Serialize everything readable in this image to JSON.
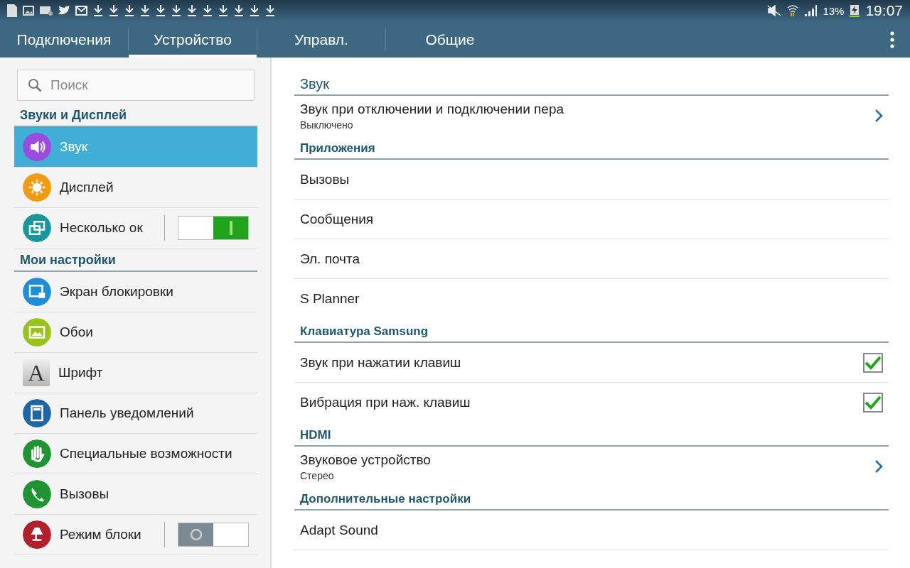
{
  "status_bar": {
    "battery": "13%",
    "time": "19:07"
  },
  "tabs": [
    {
      "label": "Подключения",
      "selected": false
    },
    {
      "label": "Устройство",
      "selected": true
    },
    {
      "label": "Управл.",
      "selected": false
    },
    {
      "label": "Общие",
      "selected": false
    }
  ],
  "sidebar": {
    "search": {
      "placeholder": "Поиск"
    },
    "groups": [
      {
        "title": "Звуки и Дисплей",
        "items": [
          {
            "label": "Звук",
            "color": "#9b4be0",
            "selected": true,
            "kind": "link"
          },
          {
            "label": "Дисплей",
            "color": "#f39a13",
            "selected": false,
            "kind": "link"
          },
          {
            "label": "Несколько ок",
            "color": "#16989a",
            "selected": false,
            "kind": "switch",
            "on": true
          }
        ]
      },
      {
        "title": "Мои настройки",
        "items": [
          {
            "label": "Экран блокировки",
            "color": "#1e8fd6",
            "selected": false,
            "kind": "link"
          },
          {
            "label": "Обои",
            "color": "#97c31a",
            "selected": false,
            "kind": "link"
          },
          {
            "label": "Шрифт",
            "color": "#b5b5b5",
            "selected": false,
            "kind": "link",
            "icon_text": "A"
          },
          {
            "label": "Панель уведомлений",
            "color": "#1f66a8",
            "selected": false,
            "kind": "link"
          },
          {
            "label": "Специальные возможности",
            "color": "#1f9433",
            "selected": false,
            "kind": "link"
          },
          {
            "label": "Вызовы",
            "color": "#1f9433",
            "selected": false,
            "kind": "link"
          },
          {
            "label": "Режим блоки",
            "color": "#b3202c",
            "selected": false,
            "kind": "switch",
            "on": false
          }
        ]
      }
    ]
  },
  "content": {
    "sections": [
      {
        "title": "Звук",
        "items": [
          {
            "kind": "link",
            "label": "Звук при отключении и подключении пера",
            "sub": "Выключено"
          }
        ]
      },
      {
        "title": "Приложения",
        "items": [
          {
            "kind": "plain",
            "label": "Вызовы"
          },
          {
            "kind": "plain",
            "label": "Сообщения"
          },
          {
            "kind": "plain",
            "label": "Эл. почта"
          },
          {
            "kind": "plain",
            "label": "S Planner"
          }
        ]
      },
      {
        "title": "Клавиатура Samsung",
        "items": [
          {
            "kind": "checkbox",
            "label": "Звук при нажатии клавиш",
            "checked": true
          },
          {
            "kind": "checkbox",
            "label": "Вибрация при наж. клавиш",
            "checked": true
          }
        ]
      },
      {
        "title": "HDMI",
        "items": [
          {
            "kind": "link",
            "label": "Звуковое устройство",
            "sub": "Стерео"
          }
        ]
      },
      {
        "title": "Дополнительные настройки",
        "items": [
          {
            "kind": "plain",
            "label": "Adapt Sound"
          }
        ]
      }
    ]
  }
}
